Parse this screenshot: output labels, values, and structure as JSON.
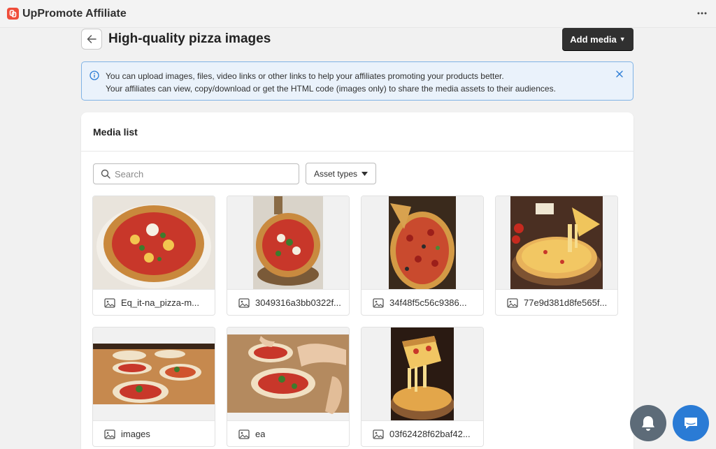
{
  "app": {
    "title": "UpPromote Affiliate",
    "logo_glyph": "Up",
    "brand_color": "#ef4d3a",
    "more_icon": "more-horizontal-icon"
  },
  "page": {
    "title": "High-quality pizza images",
    "back_icon": "arrow-left-icon",
    "add_media_label": "Add media"
  },
  "banner": {
    "line1": "You can upload images, files, video links or other links to help your affiliates promoting your products better.",
    "line2": "Your affiliates can view, copy/download or get the HTML code (images only) to share the media assets to their audiences.",
    "info_icon": "info-icon",
    "close_icon": "close-icon",
    "accent": "#7fb3e6"
  },
  "media_list": {
    "title": "Media list",
    "search": {
      "placeholder": "Search",
      "value": ""
    },
    "asset_types_label": "Asset types",
    "items": [
      {
        "name": "Eq_it-na_pizza-m...",
        "type_icon": "image-icon",
        "thumb": "pizza-whole-plate"
      },
      {
        "name": "3049316a3bb0322f...",
        "type_icon": "image-icon",
        "thumb": "pizza-board-portrait"
      },
      {
        "name": "34f48f5c56c9386...",
        "type_icon": "image-icon",
        "thumb": "pizza-pepperoni-slices"
      },
      {
        "name": "77e9d381d8fe565f...",
        "type_icon": "image-icon",
        "thumb": "pizza-cheese-pull"
      },
      {
        "name": "images",
        "type_icon": "image-icon",
        "thumb": "pizzas-on-peels"
      },
      {
        "name": "ea",
        "type_icon": "image-icon",
        "thumb": "pizza-dough-hands"
      },
      {
        "name": "03f62428f62baf42...",
        "type_icon": "image-icon",
        "thumb": "pizza-slice-lift"
      }
    ]
  },
  "floating": {
    "notifications_icon": "bell-icon",
    "chat_icon": "chat-icon"
  }
}
